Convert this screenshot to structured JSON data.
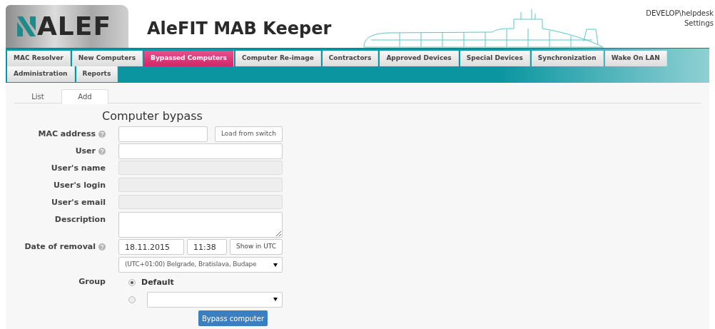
{
  "header": {
    "logo": "ALEF",
    "title": "AleFIT MAB Keeper",
    "user": "DEVELOP\\helpdesk",
    "settings": "Settings"
  },
  "nav": [
    {
      "label": "MAC Resolver",
      "selected": false
    },
    {
      "label": "New Computers",
      "selected": false
    },
    {
      "label": "Bypassed Computers",
      "selected": true
    },
    {
      "label": "Computer Re-image",
      "selected": false
    },
    {
      "label": "Contractors",
      "selected": false
    },
    {
      "label": "Approved Devices",
      "selected": false
    },
    {
      "label": "Special Devices",
      "selected": false
    },
    {
      "label": "Synchronization",
      "selected": false
    },
    {
      "label": "Wake On LAN",
      "selected": false
    },
    {
      "label": "Administration",
      "selected": false
    },
    {
      "label": "Reports",
      "selected": false
    }
  ],
  "subtabs": [
    {
      "label": "List",
      "selected": false
    },
    {
      "label": "Add",
      "selected": true
    }
  ],
  "form": {
    "title": "Computer bypass",
    "fields": [
      {
        "kind": "text",
        "label": "MAC address",
        "help": true,
        "button": "Load from switch"
      },
      {
        "kind": "text",
        "label": "User",
        "help": true
      },
      {
        "kind": "readonly",
        "label": "User's name",
        "help": false
      },
      {
        "kind": "readonly",
        "label": "User's login",
        "help": false
      },
      {
        "kind": "readonly",
        "label": "User's email",
        "help": false
      },
      {
        "kind": "textarea",
        "label": "Description",
        "help": false
      },
      {
        "kind": "date",
        "label": "Date of removal",
        "help": true,
        "date": "18.11.2015",
        "time": "11:38",
        "button": "Show in UTC",
        "timezone": "(UTC+01:00) Belgrade, Bratislava, Budape"
      },
      {
        "kind": "group",
        "label": "Group",
        "help": false,
        "options": [
          {
            "label": "Default",
            "selected": true
          },
          {
            "selected": false
          }
        ]
      }
    ],
    "submit": "Bypass computer"
  }
}
